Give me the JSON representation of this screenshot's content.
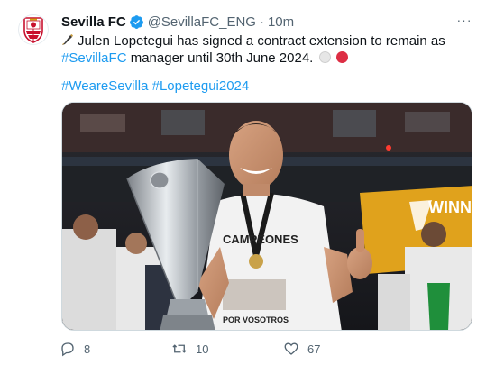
{
  "tweet": {
    "author_name": "Sevilla FC",
    "handle": "@SevillaFC_ENG",
    "separator": "·",
    "time": "10m",
    "more_label": "···",
    "text_part1": "Julen Lopetegui has signed a contract extension to remain as ",
    "text_link": "#SevillaFC",
    "text_part2": " manager until 30th June 2024.",
    "hashtag_1": "#WeareSevilla",
    "hashtag_2": "#Lopetegui2024",
    "image_texts": {
      "shirt_top": "CAMPEONES",
      "shirt_bottom": "POR VOSOTROS",
      "banner": "WINN"
    },
    "reply_count": "8",
    "retweet_count": "10",
    "like_count": "67"
  },
  "colors": {
    "accent": "#1d9bf0",
    "text": "#0f1419",
    "muted": "#536471",
    "brand_red": "#dd2e44"
  },
  "icons": {
    "verified": "verified-badge-icon",
    "pen": "fountain-pen-emoji",
    "reply": "reply-icon",
    "retweet": "retweet-icon",
    "like": "heart-icon"
  }
}
